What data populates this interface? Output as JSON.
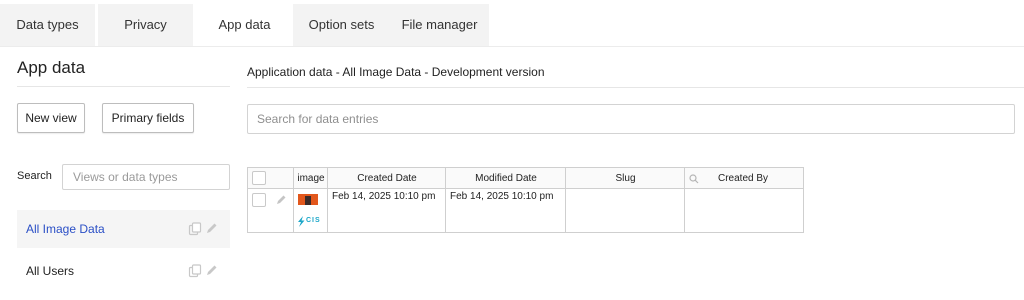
{
  "tabs": [
    {
      "label": "Data types",
      "active": false
    },
    {
      "label": "Privacy",
      "active": false
    },
    {
      "label": "App data",
      "active": true
    },
    {
      "label": "Option sets",
      "active": false
    },
    {
      "label": "File manager",
      "active": false
    }
  ],
  "sidebar": {
    "title": "App data",
    "new_view_label": "New view",
    "primary_fields_label": "Primary fields",
    "search_label": "Search",
    "search_placeholder": "Views or data types",
    "items": [
      {
        "label": "All Image Data",
        "active": true
      },
      {
        "label": "All Users",
        "active": false
      }
    ]
  },
  "main": {
    "title": "Application data - All Image Data - Development version",
    "search_placeholder": "Search for data entries",
    "table": {
      "columns": [
        "image",
        "Created Date",
        "Modified Date",
        "Slug",
        "Created By"
      ],
      "rows": [
        {
          "image_label": "CIS",
          "created": "Feb 14, 2025 10:10 pm",
          "modified": "Feb 14, 2025 10:10 pm",
          "slug": "",
          "created_by": ""
        }
      ]
    }
  },
  "colors": {
    "accent_link": "#2a4fc6",
    "logo_teal": "#1aa6c8",
    "thumb_orange": "#e2571c",
    "thumb_dark": "#3a2a28"
  }
}
